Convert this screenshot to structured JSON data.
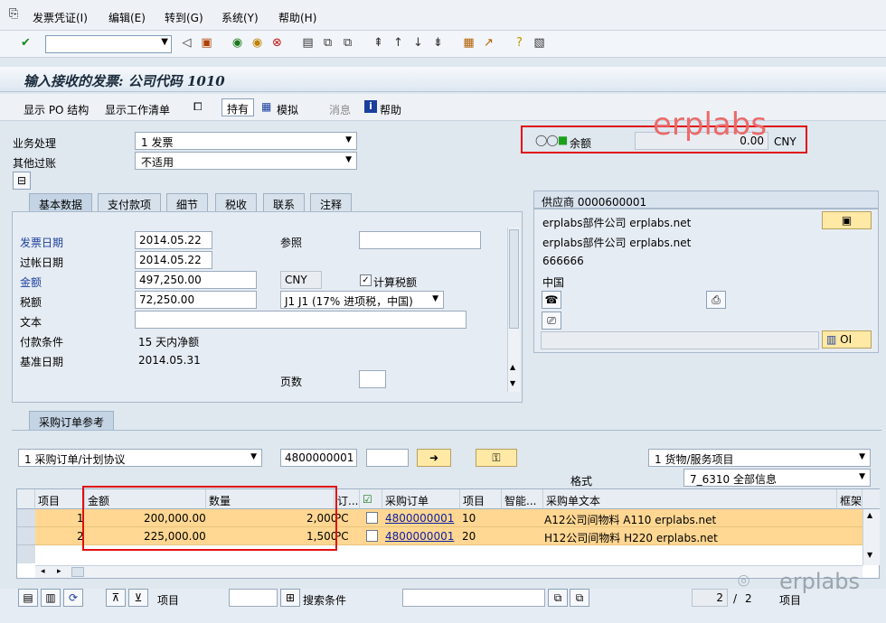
{
  "menu": {
    "items": [
      "发票凭证(I)",
      "编辑(E)",
      "转到(G)",
      "系统(Y)",
      "帮助(H)"
    ]
  },
  "title": "输入接收的发票: 公司代码 1010",
  "app_toolbar": {
    "show_po_structure": "显示 PO 结构",
    "show_worklist": "显示工作清单",
    "hold": "持有",
    "simulate": "模拟",
    "delete": "消息",
    "help": "帮助"
  },
  "header": {
    "transaction_label": "业务处理",
    "transaction_value": "1 发票",
    "other_posting_label": "其他过账",
    "other_posting_value": "不适用",
    "balance_label": "余额",
    "balance_value": "0.00",
    "balance_currency": "CNY",
    "watermark": "erplabs"
  },
  "tabs": [
    "基本数据",
    "支付款项",
    "细节",
    "税收",
    "联系",
    "注释"
  ],
  "basic": {
    "invoice_date_label": "发票日期",
    "invoice_date": "2014.05.22",
    "reference_label": "参照",
    "posting_date_label": "过帐日期",
    "posting_date": "2014.05.22",
    "amount_label": "金额",
    "amount": "497,250.00",
    "currency": "CNY",
    "calc_tax_label": "计算税额",
    "tax_label": "税额",
    "tax_amount": "72,250.00",
    "tax_code": "J1 J1 (17% 进项税，中国)",
    "text_label": "文本",
    "payment_terms_label": "付款条件",
    "payment_terms": "15 天内净额",
    "baseline_label": "基准日期",
    "baseline_date": "2014.05.31",
    "pages_label": "页数"
  },
  "vendor": {
    "header": "供应商 0000600001",
    "line1": "erplabs部件公司 erplabs.net",
    "line2": "erplabs部件公司 erplabs.net",
    "line3": "666666",
    "line4": "中国",
    "oi_label": "OI"
  },
  "po_ref": {
    "tab_label": "采购订单参考",
    "ref_type": "1 采购订单/计划协议",
    "po_number": "4800000001",
    "item_type": "1 货物/服务项目",
    "layout_label": "格式",
    "layout_value": "7_6310 全部信息"
  },
  "grid": {
    "headers": [
      "项目",
      "金额",
      "数量",
      "订...",
      "采购订单",
      "项目",
      "智能...",
      "采购单文本",
      "框架"
    ],
    "rows": [
      {
        "item": "1",
        "amount": "200,000.00",
        "qty": "2,000",
        "unit": "PC",
        "po": "4800000001",
        "po_item": "10",
        "text": "A12公司间物料 A110 erplabs.net"
      },
      {
        "item": "2",
        "amount": "225,000.00",
        "qty": "1,500",
        "unit": "PC",
        "po": "4800000001",
        "po_item": "20",
        "text": "H12公司间物料 H220 erplabs.net"
      }
    ]
  },
  "bottom": {
    "item_label": "项目",
    "search_label": "搜索条件",
    "page_current": "2",
    "page_sep": "/",
    "page_total": "2",
    "page_unit": "项目",
    "logo_text": "erplabs"
  }
}
